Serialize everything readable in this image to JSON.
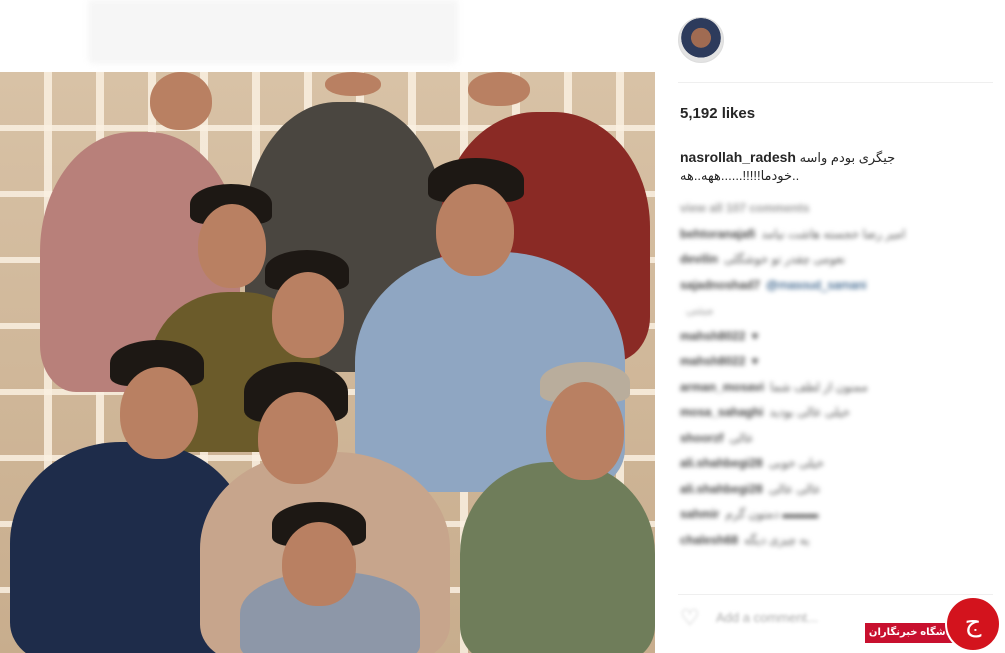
{
  "post": {
    "likes": "5,192 likes",
    "username": "nasrollah_radesh",
    "caption_line1": "جیگری بودم واسه",
    "caption_line2": "..خودما!!!!!......ههه..هه"
  },
  "comments": [
    {
      "user": "view all 107 comments",
      "text": "",
      "kind": "muted"
    },
    {
      "user": "behtoranajafi",
      "text": "امیر رضا خجسته هاشت نیامد",
      "kind": "normal"
    },
    {
      "user": "devilin",
      "text": "نعومی چقدر تو خوشگلی",
      "kind": "normal"
    },
    {
      "user": "sajadnoshad7",
      "text": "@masoud_samani",
      "kind": "tag"
    },
    {
      "user": "",
      "text": "مبتنی",
      "kind": "muted"
    },
    {
      "user": "mahsh8022",
      "text": "♥",
      "kind": "normal"
    },
    {
      "user": "mahsh8022",
      "text": "♥",
      "kind": "normal"
    },
    {
      "user": "arman_mosavi",
      "text": "ممنون از لطف شما",
      "kind": "normal"
    },
    {
      "user": "mosa_sahaghi",
      "text": "خیلی عالی بودید",
      "kind": "normal"
    },
    {
      "user": "shoorzf",
      "text": "عالی",
      "kind": "normal"
    },
    {
      "user": "ali.shahbegi28",
      "text": "خیلی خوبی",
      "kind": "normal"
    },
    {
      "user": "ali.shahbegi28",
      "text": "عالی عالی",
      "kind": "normal"
    },
    {
      "user": "sahmir",
      "text": "دمتون گرم ▬▬▬",
      "kind": "normal"
    },
    {
      "user": "chalesh68",
      "text": "یه چیزی دیگه",
      "kind": "normal"
    }
  ],
  "footer": {
    "add_comment_placeholder": "Add a comment..."
  },
  "watermark": {
    "site": "باشگاه خبرنگاران",
    "symbol": "ج"
  },
  "colors": {
    "watermark_red": "#d3131d",
    "text": "#262626"
  }
}
